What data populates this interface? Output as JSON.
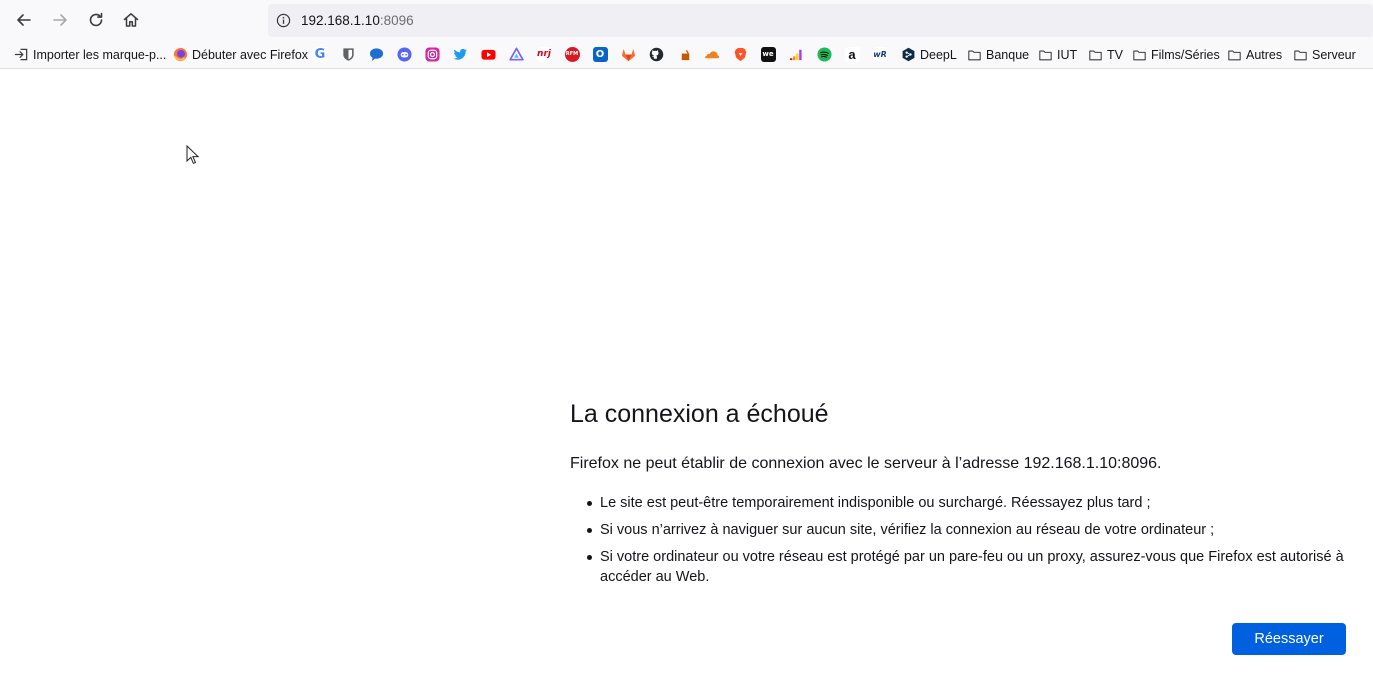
{
  "navbar": {
    "url_host": "192.168.1.10",
    "url_port": ":8096",
    "icons": [
      "back-arrow-icon",
      "forward-arrow-icon",
      "reload-icon",
      "home-icon",
      "info-icon"
    ]
  },
  "bookmarks": [
    {
      "label": "Importer les marque-p...",
      "icon": "import-icon"
    },
    {
      "label": "Débuter avec Firefox",
      "icon": "firefox-icon"
    },
    {
      "label": "",
      "icon": "google-icon",
      "glyph": "G",
      "color": "#4285f4"
    },
    {
      "label": "",
      "icon": "bitwarden-icon",
      "glyph": "",
      "color": "#5f6368"
    },
    {
      "label": "",
      "icon": "chat-icon",
      "glyph": "",
      "color": "#1f6fd0"
    },
    {
      "label": "",
      "icon": "discord-icon",
      "glyph": "",
      "color": "#5865f2"
    },
    {
      "label": "",
      "icon": "instagram-icon",
      "glyph": "",
      "color": "#d6249f"
    },
    {
      "label": "",
      "icon": "twitter-icon",
      "glyph": "",
      "color": "#1d9bf0"
    },
    {
      "label": "",
      "icon": "youtube-icon",
      "glyph": "",
      "color": "#ff0000"
    },
    {
      "label": "",
      "icon": "triangle-app-icon",
      "glyph": "",
      "color": "#7b61ff"
    },
    {
      "label": "",
      "icon": "nrj-icon",
      "glyph": "nrj",
      "color": "#e2001a"
    },
    {
      "label": "",
      "icon": "rfm-icon",
      "glyph": "RFM",
      "color": "#d71920"
    },
    {
      "label": "",
      "icon": "outlook-icon",
      "glyph": "O",
      "color": "#0a64c8"
    },
    {
      "label": "",
      "icon": "gitlab-icon",
      "glyph": "",
      "color": "#fc6d26"
    },
    {
      "label": "",
      "icon": "github-icon",
      "glyph": "",
      "color": "#24292f"
    },
    {
      "label": "",
      "icon": "cup-icon",
      "glyph": "",
      "color": "#c45a00"
    },
    {
      "label": "",
      "icon": "cloudflare-icon",
      "glyph": "",
      "color": "#f38020"
    },
    {
      "label": "",
      "icon": "brave-icon",
      "glyph": "",
      "color": "#fb542b"
    },
    {
      "label": "",
      "icon": "wetransfer-icon",
      "glyph": "we",
      "color": "#111111"
    },
    {
      "label": "",
      "icon": "deezer-icon",
      "glyph": "",
      "color": "#a238ff"
    },
    {
      "label": "",
      "icon": "spotify-icon",
      "glyph": "",
      "color": "#1db954"
    },
    {
      "label": "",
      "icon": "amazon-icon",
      "glyph": "a",
      "color": "#111111"
    },
    {
      "label": "",
      "icon": "wordreference-icon",
      "glyph": "wR",
      "color": "#1b3a8c"
    },
    {
      "label": "DeepL",
      "icon": "deepl-icon"
    },
    {
      "label": "Banque",
      "icon": "folder-icon"
    },
    {
      "label": "IUT",
      "icon": "folder-icon"
    },
    {
      "label": "TV",
      "icon": "folder-icon"
    },
    {
      "label": "Films/Séries",
      "icon": "folder-icon"
    },
    {
      "label": "Autres",
      "icon": "folder-icon"
    },
    {
      "label": "Serveur",
      "icon": "folder-icon"
    }
  ],
  "error_page": {
    "title": "La connexion a échoué",
    "description": "Firefox ne peut établir de connexion avec le serveur à l’adresse 192.168.1.10:8096.",
    "reasons": [
      "Le site est peut-être temporairement indisponible ou surchargé. Réessayez plus tard ;",
      "Si vous n’arrivez à naviguer sur aucun site, vérifiez la connexion au réseau de votre ordinateur ;",
      "Si votre ordinateur ou votre réseau est protégé par un pare-feu ou un proxy, assurez-vous que Firefox est autorisé à accéder au Web."
    ],
    "retry_label": "Réessayer"
  },
  "colors": {
    "accent": "#0061e0",
    "toolbar_bg": "#f9f9fb",
    "urlbar_bg": "#f0f0f4",
    "text": "#15141a"
  }
}
